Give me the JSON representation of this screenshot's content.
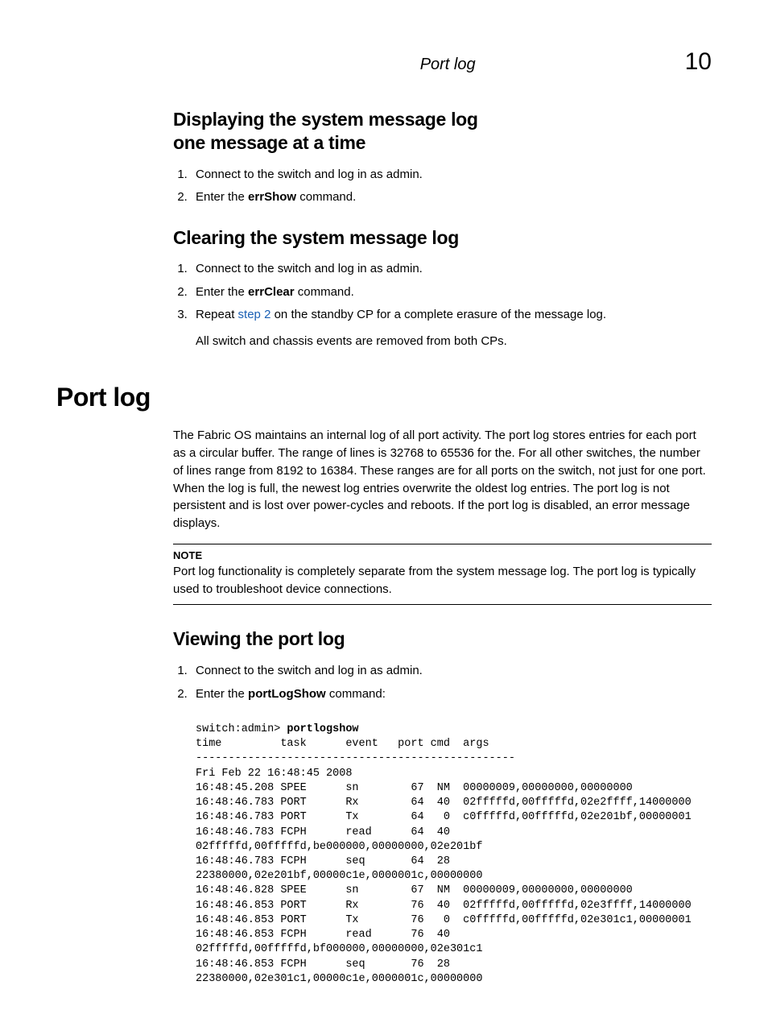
{
  "header": {
    "running_title": "Port log",
    "chapter_num": "10"
  },
  "sec1": {
    "heading_line1": "Displaying the system message log",
    "heading_line2": "one message at a time",
    "step1": "Connect to the switch and log in as admin.",
    "step2_pre": "Enter the ",
    "step2_cmd": "errShow",
    "step2_post": " command."
  },
  "sec2": {
    "heading": "Clearing the system message log",
    "step1": "Connect to the switch and log in as admin.",
    "step2_pre": "Enter the ",
    "step2_cmd": "errClear",
    "step2_post": " command.",
    "step3_pre": "Repeat ",
    "step3_link": "step 2",
    "step3_post": " on the standby CP for a complete erasure of the message log.",
    "step3_result": "All switch and chassis events are removed from both CPs."
  },
  "sec3": {
    "heading": "Port log",
    "para": "The Fabric OS maintains an internal log of all port activity. The port log stores entries for each port as a circular buffer. The range of lines is 32768 to 65536 for the. For all other switches, the number of lines range from 8192 to 16384. These ranges are for all ports on the switch, not just for one port. When the log is full, the newest log entries overwrite the oldest log entries. The port log is not persistent and is lost over power-cycles and reboots. If the port log is disabled, an error message displays.",
    "note_label": "NOTE",
    "note_text": "Port log functionality is completely separate from the system message log. The port log is typically used to troubleshoot device connections."
  },
  "sec4": {
    "heading": "Viewing the port log",
    "step1": "Connect to the switch and log in as admin.",
    "step2_pre": "Enter the ",
    "step2_cmd": "portLogShow",
    "step2_post": " command:",
    "console_prompt": "switch:admin> ",
    "console_cmd": "portlogshow",
    "console_body": "time         task      event   port cmd  args\n-------------------------------------------------\nFri Feb 22 16:48:45 2008\n16:48:45.208 SPEE      sn        67  NM  00000009,00000000,00000000\n16:48:46.783 PORT      Rx        64  40  02fffffd,00fffffd,02e2ffff,14000000\n16:48:46.783 PORT      Tx        64   0  c0fffffd,00fffffd,02e201bf,00000001\n16:48:46.783 FCPH      read      64  40 \n02fffffd,00fffffd,be000000,00000000,02e201bf\n16:48:46.783 FCPH      seq       64  28 \n22380000,02e201bf,00000c1e,0000001c,00000000\n16:48:46.828 SPEE      sn        67  NM  00000009,00000000,00000000\n16:48:46.853 PORT      Rx        76  40  02fffffd,00fffffd,02e3ffff,14000000\n16:48:46.853 PORT      Tx        76   0  c0fffffd,00fffffd,02e301c1,00000001\n16:48:46.853 FCPH      read      76  40 \n02fffffd,00fffffd,bf000000,00000000,02e301c1\n16:48:46.853 FCPH      seq       76  28 \n22380000,02e301c1,00000c1e,0000001c,00000000"
  }
}
